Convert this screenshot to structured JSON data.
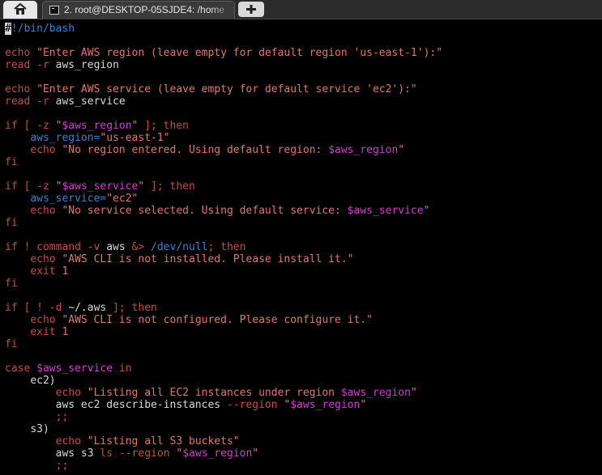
{
  "tabbar": {
    "home_icon": "home-icon",
    "tab_title": "2. root@DESKTOP-05SJDE4: /home",
    "terminal_icon": "terminal-icon",
    "new_tab_icon": "plus-icon"
  },
  "colors": {
    "background": "#000000",
    "keyword": "#c94a4a",
    "string": "#e07575",
    "variable": "#d43ad4",
    "path": "#3d7fd0",
    "default": "#e8e8e8"
  },
  "code": {
    "shebang_cursor": "#",
    "shebang_rest": "!/bin/bash",
    "l3": {
      "cmd": "echo",
      "str": "\"Enter AWS region (leave empty for default region 'us-east-1'):\""
    },
    "l4": {
      "cmd": "read",
      "flag": "-r",
      "arg": "aws_region"
    },
    "l6": {
      "cmd": "echo",
      "str": "\"Enter AWS service (leave empty for default service 'ec2'):\""
    },
    "l7": {
      "cmd": "read",
      "flag": "-r",
      "arg": "aws_service"
    },
    "l9": {
      "a": "if [ -z ",
      "q1": "\"",
      "v": "$aws_region",
      "q2": "\"",
      "b": " ]; then"
    },
    "l10": {
      "name": "aws_region=",
      "str": "\"us-east-1\""
    },
    "l11": {
      "cmd": "echo",
      "str": "\"No region entered. Using default region: ",
      "v": "$aws_region",
      "end": "\""
    },
    "l12": "fi",
    "l14": {
      "a": "if [ -z ",
      "q1": "\"",
      "v": "$aws_service",
      "q2": "\"",
      "b": " ]; then"
    },
    "l15": {
      "name": "aws_service=",
      "str": "\"ec2\""
    },
    "l16": {
      "cmd": "echo",
      "str": "\"No service selected. Using default service: ",
      "v": "$aws_service",
      "end": "\""
    },
    "l17": "fi",
    "l19": {
      "a": "if ! command -v ",
      "w": "aws",
      "op": "&>",
      "p": "/dev/null",
      "b": "; then"
    },
    "l20": {
      "cmd": "echo",
      "str": "\"AWS CLI is not installed. Please install it.\""
    },
    "l21": {
      "cmd": "exit",
      "n": "1"
    },
    "l22": "fi",
    "l24": {
      "a": "if [ ! -d ",
      "w": "~/.aws",
      "b": " ]; then"
    },
    "l25": {
      "cmd": "echo",
      "str": "\"AWS CLI is not configured. Please configure it.\""
    },
    "l26": {
      "cmd": "exit",
      "n": "1"
    },
    "l27": "fi",
    "l29": {
      "a": "case ",
      "v": "$aws_service",
      "b": " in"
    },
    "l30": "ec2)",
    "l31": {
      "cmd": "echo",
      "str": "\"Listing all EC2 instances under region ",
      "v": "$aws_region",
      "end": "\""
    },
    "l32": {
      "a": "aws ec2 describe-instances ",
      "f": "--region",
      "q1": "\"",
      "v": "$aws_region",
      "q2": "\""
    },
    "l33": ";;",
    "l34": "s3)",
    "l35": {
      "cmd": "echo",
      "str": "\"Listing all S3 buckets\""
    },
    "l36": {
      "a": "aws s3 ",
      "ls": "ls",
      "f": "--region",
      "q1": "\"",
      "v": "$aws_region",
      "q2": "\""
    },
    "l37": ";;"
  }
}
